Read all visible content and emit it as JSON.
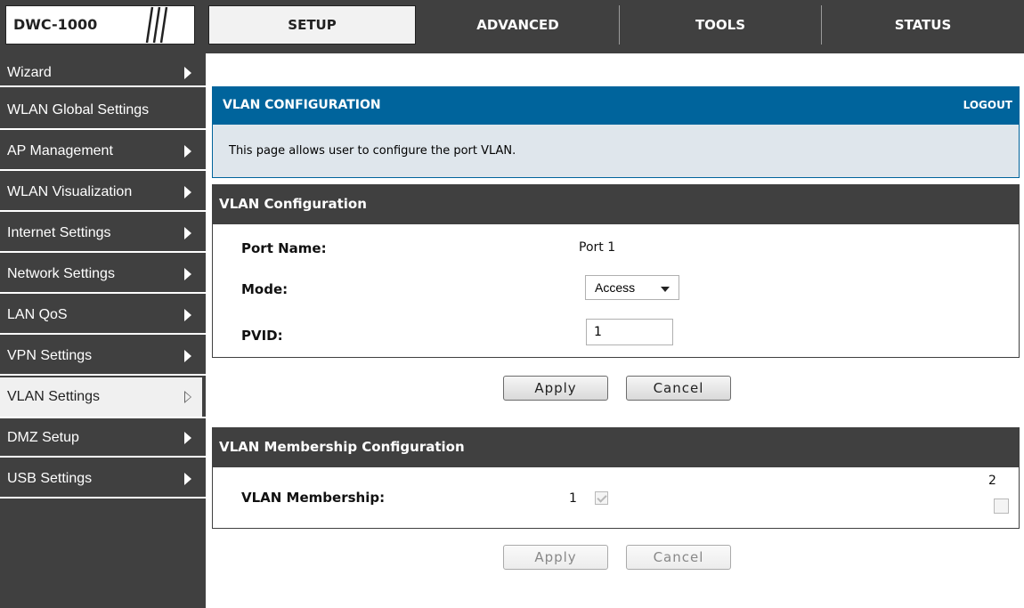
{
  "header": {
    "logo": "DWC-1000",
    "tabs": [
      {
        "label": "SETUP",
        "active": true
      },
      {
        "label": "ADVANCED",
        "active": false
      },
      {
        "label": "TOOLS",
        "active": false
      },
      {
        "label": "STATUS",
        "active": false
      }
    ]
  },
  "sidebar": {
    "items": [
      {
        "label": "Wizard"
      },
      {
        "label": "WLAN Global Settings"
      },
      {
        "label": "AP Management"
      },
      {
        "label": "WLAN Visualization"
      },
      {
        "label": "Internet Settings"
      },
      {
        "label": "Network Settings"
      },
      {
        "label": "LAN QoS"
      },
      {
        "label": "VPN Settings"
      },
      {
        "label": "VLAN Settings",
        "active": true
      },
      {
        "label": "DMZ Setup"
      },
      {
        "label": "USB Settings"
      }
    ]
  },
  "page": {
    "title": "VLAN CONFIGURATION",
    "logout": "LOGOUT",
    "description": "This page allows user to configure the port VLAN."
  },
  "vlan_config": {
    "heading": "VLAN Configuration",
    "port_name_label": "Port Name:",
    "port_name_value": "Port 1",
    "mode_label": "Mode:",
    "mode_value": "Access",
    "pvid_label": "PVID:",
    "pvid_value": "1",
    "apply": "Apply",
    "cancel": "Cancel"
  },
  "membership": {
    "heading": "VLAN Membership Configuration",
    "label": "VLAN Membership:",
    "vlans": [
      {
        "id": "1",
        "checked": true,
        "disabled": true
      },
      {
        "id": "2",
        "checked": false,
        "disabled": false
      }
    ],
    "apply": "Apply",
    "cancel": "Cancel"
  },
  "colors": {
    "nav_dark": "#404040",
    "title_blue": "#00649c",
    "info_bg": "#dfe6ec"
  }
}
